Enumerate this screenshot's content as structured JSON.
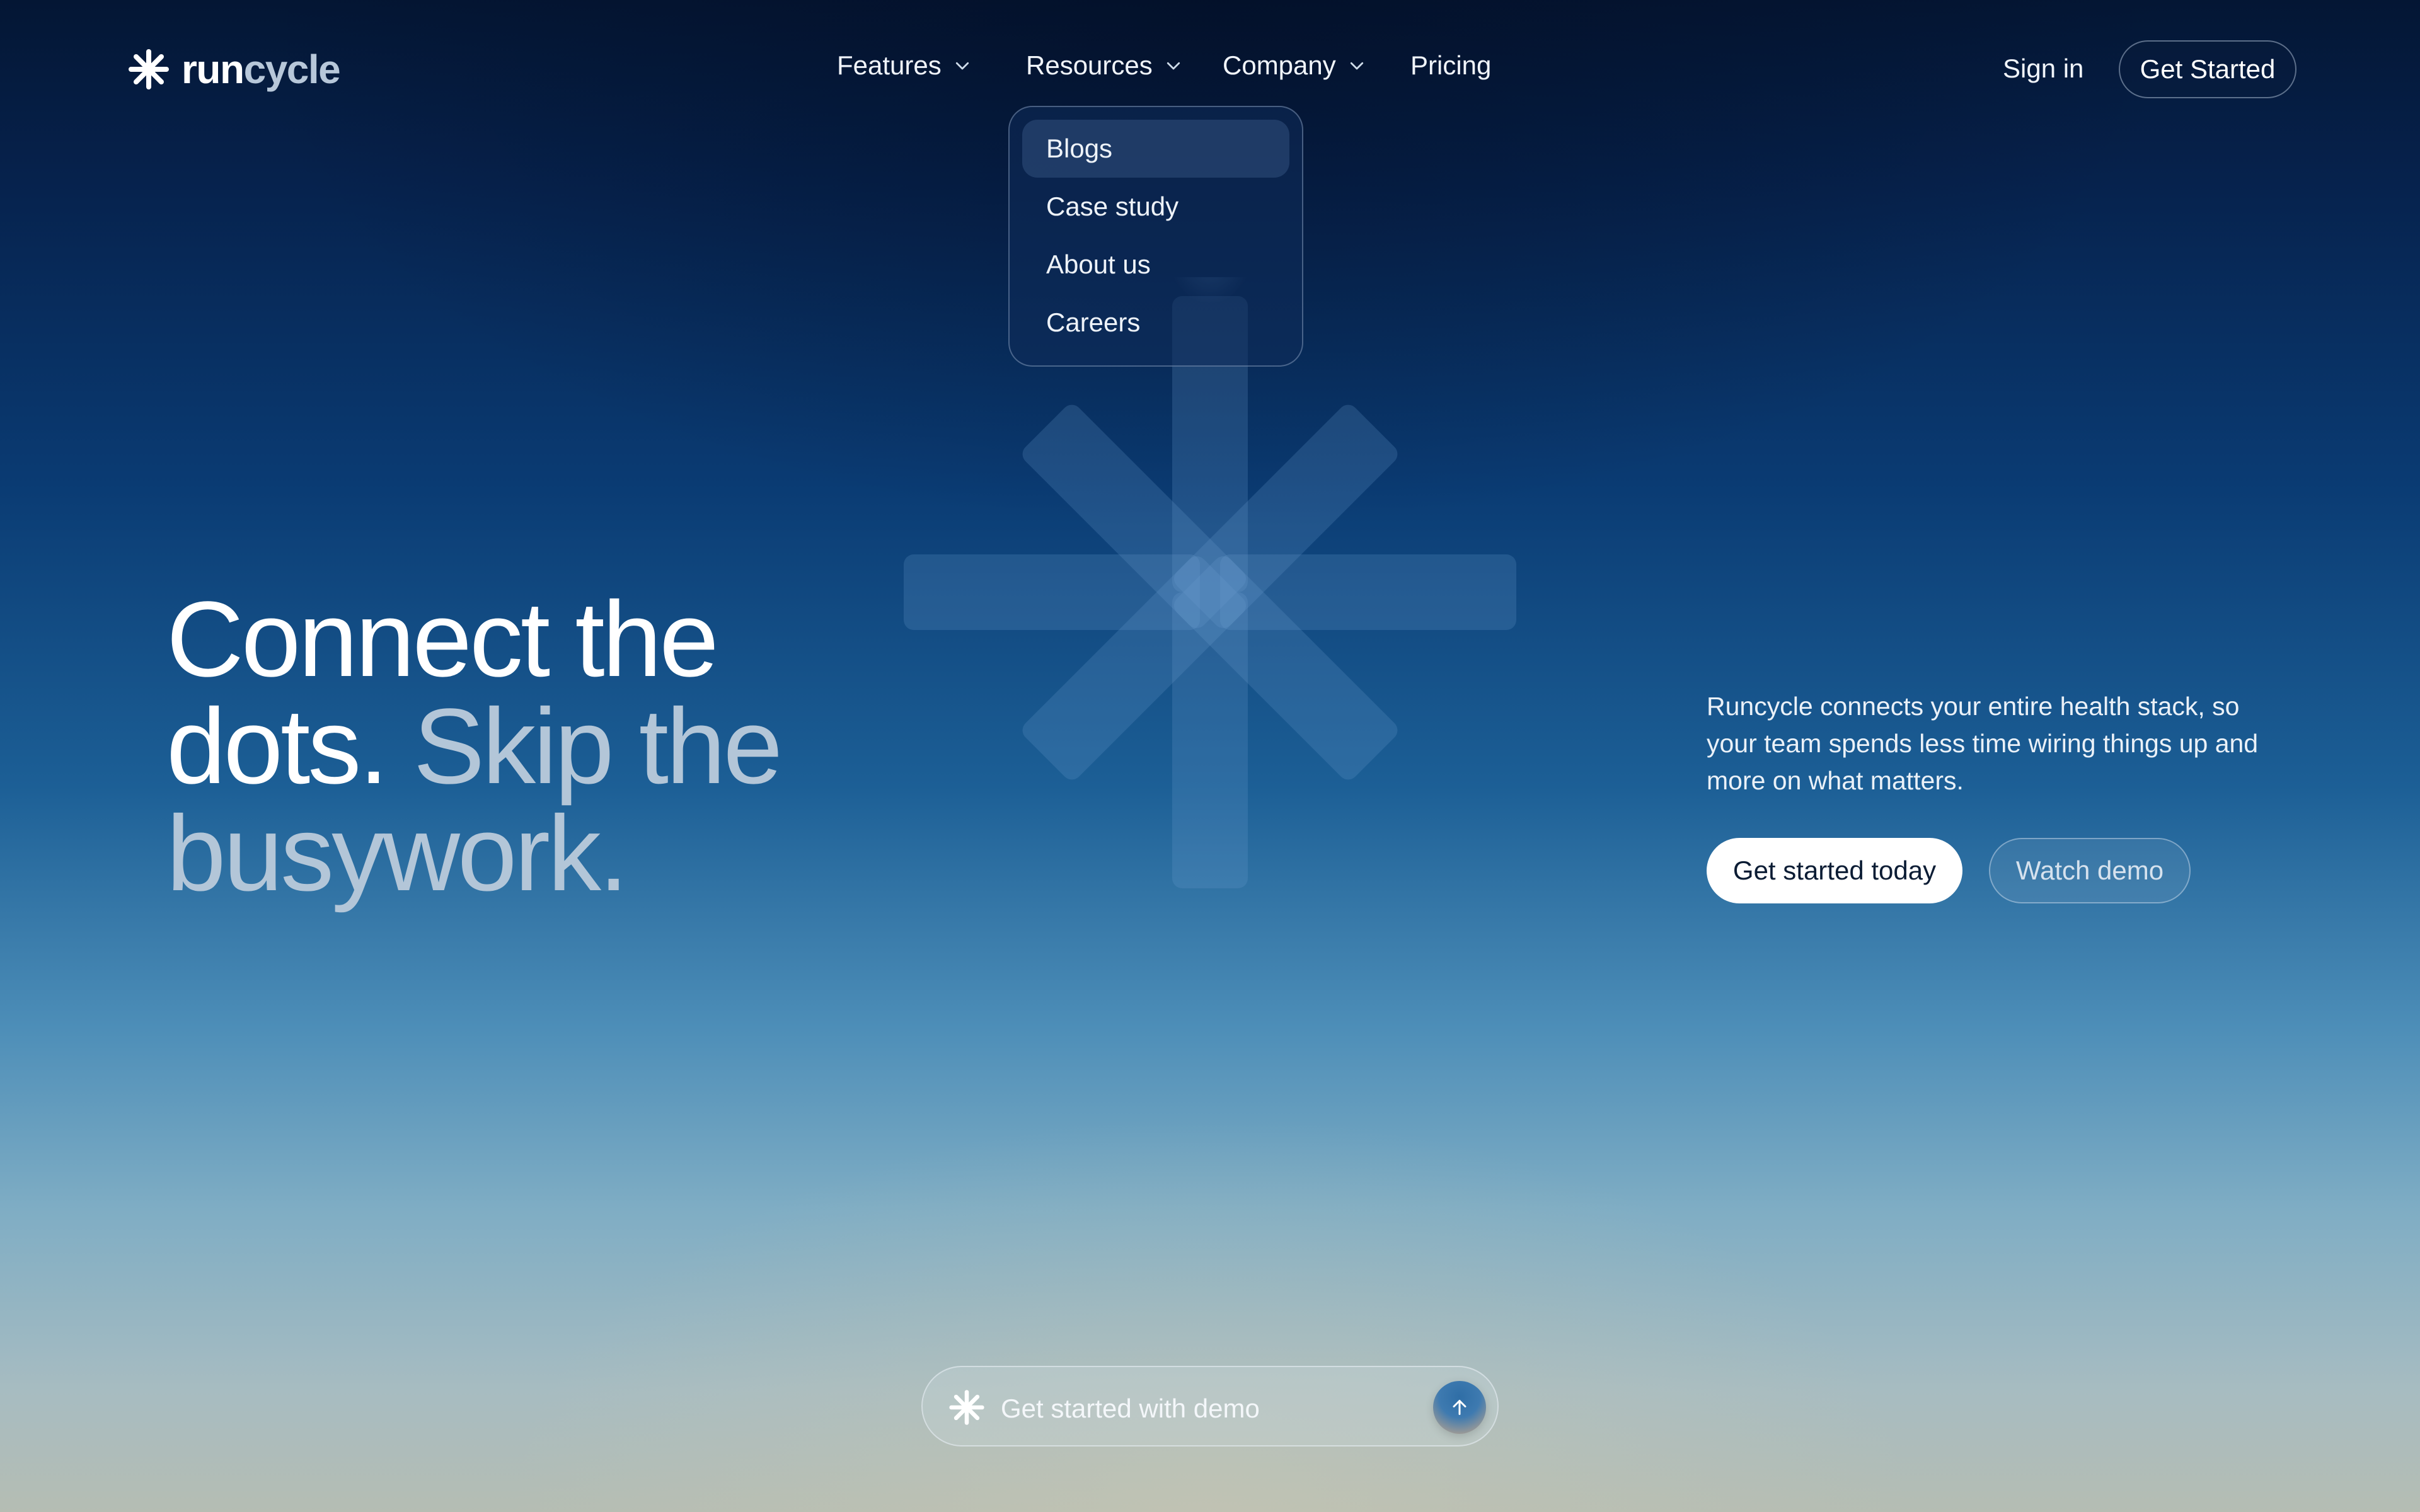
{
  "brand": {
    "name_part1": "run",
    "name_part2": "cycle"
  },
  "nav": {
    "features": "Features",
    "resources": "Resources",
    "company": "Company",
    "pricing": "Pricing"
  },
  "header": {
    "sign_in": "Sign in",
    "get_started": "Get Started"
  },
  "resources_menu": {
    "items": [
      {
        "label": "Blogs",
        "active": true
      },
      {
        "label": "Case study",
        "active": false
      },
      {
        "label": "About us",
        "active": false
      },
      {
        "label": "Careers",
        "active": false
      }
    ]
  },
  "hero": {
    "headline_line1": "Connect the",
    "headline_line2_white": "dots.",
    "headline_line2_muted": "Skip the",
    "headline_line3": "busywork.",
    "description": "Runcycle connects your entire health stack, so your team spends less time wiring things up and more on what matters.",
    "primary_cta": "Get started today",
    "secondary_cta": "Watch demo"
  },
  "prompt_bar": {
    "placeholder": "Get started with demo",
    "send_icon": "arrow-up-icon"
  },
  "icons": {
    "logo": "asterisk-logo-icon",
    "chevron": "chevron-down-icon"
  },
  "colors": {
    "text_primary": "#ffffff",
    "text_muted": "#b3c6d8",
    "bg_top": "#041634",
    "bg_mid": "#0a3b73",
    "bg_bottom": "#b5bdb3",
    "button_primary_bg": "#ffffff",
    "button_primary_text": "#0b1c34"
  }
}
